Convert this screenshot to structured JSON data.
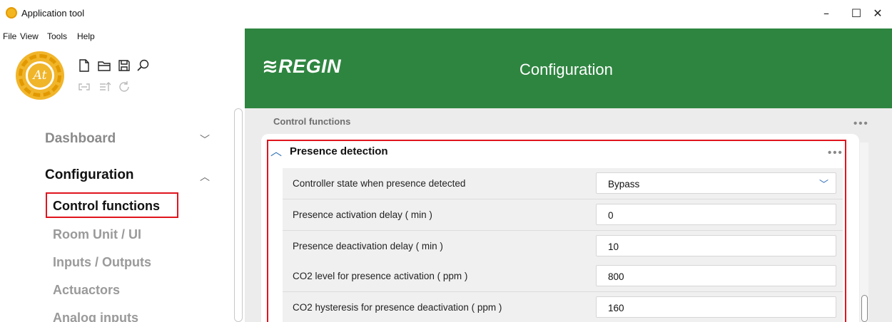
{
  "window": {
    "title": "Application tool",
    "minimize": "–",
    "maximize": "☐",
    "close": "✕"
  },
  "menu": [
    "File",
    "View",
    "Tools",
    "Help"
  ],
  "toolbar": {
    "logo_text": "At",
    "icons": [
      "new-file-icon",
      "open-folder-icon",
      "save-icon",
      "search-icon",
      "connect-icon",
      "upload-icon",
      "refresh-icon"
    ]
  },
  "header": {
    "brand": "≋REGIN",
    "title": "Configuration"
  },
  "sidebar": {
    "sections": [
      {
        "label": "Dashboard",
        "chevron": "﹀"
      },
      {
        "label": "Configuration",
        "chevron": "︿"
      }
    ],
    "items": [
      "Control functions",
      "Room Unit / UI",
      "Inputs / Outputs",
      "Actuactors",
      "Analog inputs"
    ]
  },
  "main": {
    "section_label": "Control functions",
    "more": "•••",
    "panel": {
      "title": "Presence detection",
      "expand_icon": "︿",
      "rows": [
        {
          "label": "Controller state when presence detected",
          "value": "Bypass",
          "dropdown": "﹀"
        },
        {
          "label": "Presence activation delay ( min )",
          "value": "0"
        },
        {
          "label": "Presence deactivation delay ( min )",
          "value": "10"
        },
        {
          "label": "CO2 level for presence activation ( ppm )",
          "value": "800"
        },
        {
          "label": "CO2 hysteresis for presence deactivation ( ppm )",
          "value": "160"
        }
      ]
    }
  },
  "colors": {
    "header_green": "#2e8540",
    "highlight_red": "#e0141e",
    "accent_blue": "#2f6fb7"
  }
}
